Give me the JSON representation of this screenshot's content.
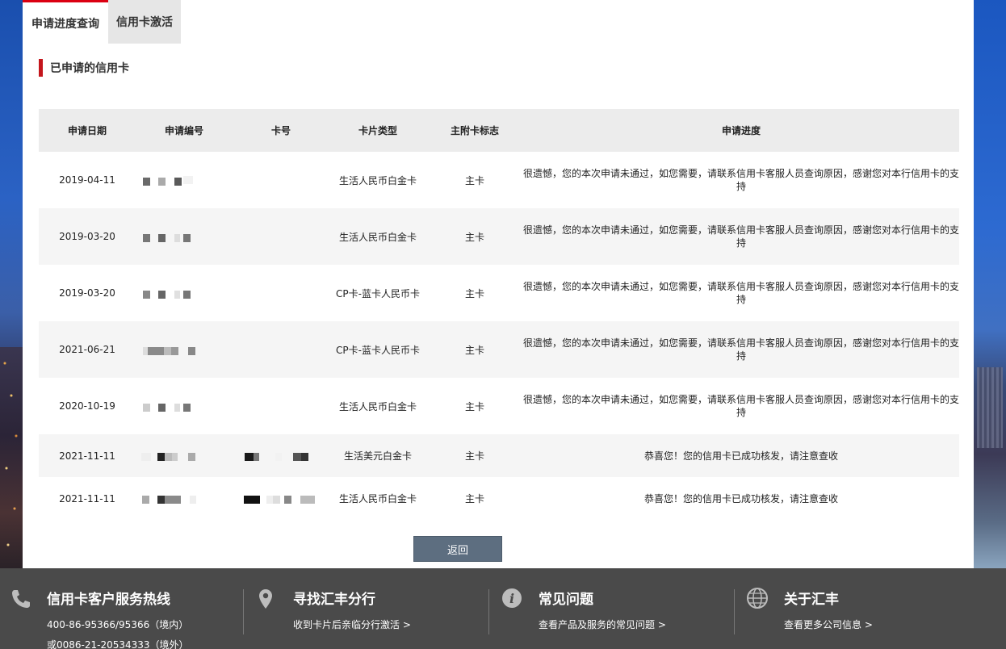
{
  "tabs": [
    {
      "label": "申请进度查询",
      "active": true
    },
    {
      "label": "信用卡激活",
      "active": false
    }
  ],
  "section_title": "已申请的信用卡",
  "table": {
    "headers": [
      "申请日期",
      "申请编号",
      "卡号",
      "卡片类型",
      "主附卡标志",
      "申请进度"
    ],
    "rows": [
      {
        "date": "2019-04-11",
        "card_type": "生活人民币白金卡",
        "flag": "主卡",
        "progress": "很遗憾，您的本次申请未通过，如您需要，请联系信用卡客服人员查询原因，感谢您对本行信用卡的支持"
      },
      {
        "date": "2019-03-20",
        "card_type": "生活人民币白金卡",
        "flag": "主卡",
        "progress": "很遗憾，您的本次申请未通过，如您需要，请联系信用卡客服人员查询原因，感谢您对本行信用卡的支持"
      },
      {
        "date": "2019-03-20",
        "card_type": "CP卡-蓝卡人民币卡",
        "flag": "主卡",
        "progress": "很遗憾，您的本次申请未通过，如您需要，请联系信用卡客服人员查询原因，感谢您对本行信用卡的支持"
      },
      {
        "date": "2021-06-21",
        "card_type": "CP卡-蓝卡人民币卡",
        "flag": "主卡",
        "progress": "很遗憾，您的本次申请未通过，如您需要，请联系信用卡客服人员查询原因，感谢您对本行信用卡的支持"
      },
      {
        "date": "2020-10-19",
        "card_type": "生活人民币白金卡",
        "flag": "主卡",
        "progress": "很遗憾，您的本次申请未通过，如您需要，请联系信用卡客服人员查询原因，感谢您对本行信用卡的支持"
      },
      {
        "date": "2021-11-11",
        "card_type": "生活美元白金卡",
        "flag": "主卡",
        "progress": "恭喜您！您的信用卡已成功核发，请注意查收"
      },
      {
        "date": "2021-11-11",
        "card_type": "生活人民币白金卡",
        "flag": "主卡",
        "progress": "恭喜您！您的信用卡已成功核发，请注意查收"
      }
    ]
  },
  "back_button": "返回",
  "footer": [
    {
      "icon": "phone-icon",
      "title": "信用卡客户服务热线",
      "lines": [
        "400-86-95366/95366（境内）",
        "或0086-21-20534333（境外）"
      ]
    },
    {
      "icon": "location-pin-icon",
      "title": "寻找汇丰分行",
      "lines": [
        "收到卡片后亲临分行激活 >"
      ]
    },
    {
      "icon": "info-icon",
      "title": "常见问题",
      "lines": [
        "查看产品及服务的常见问题 >"
      ]
    },
    {
      "icon": "globe-icon",
      "title": "关于汇丰",
      "lines": [
        "查看更多公司信息 >"
      ]
    }
  ],
  "colors": {
    "accent": "#c4161c",
    "tab_top": "#db0011",
    "footer_bg": "#4a4a4a",
    "button_bg": "#5d6e80"
  }
}
